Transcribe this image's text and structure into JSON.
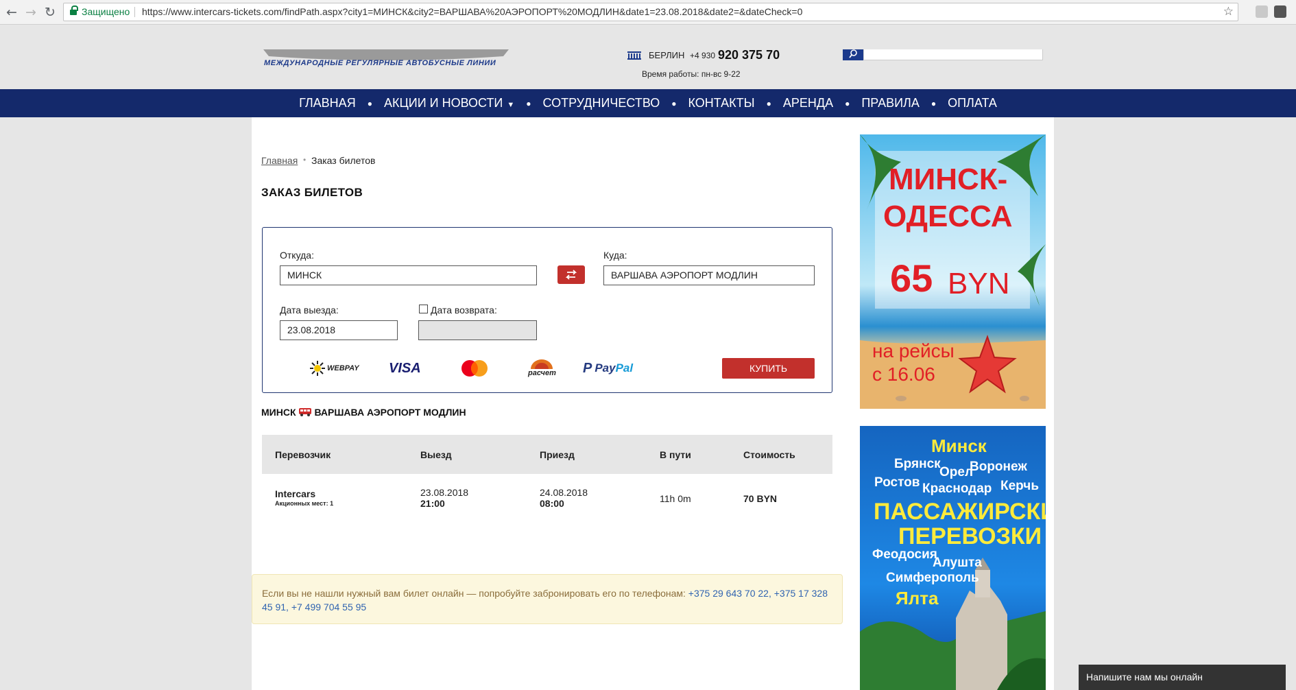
{
  "browser": {
    "secure_label": "Защищено",
    "url": "https://www.intercars-tickets.com/findPath.aspx?city1=МИНСК&city2=ВАРШАВА%20АЭРОПОРТ%20МОДЛИН&date1=23.08.2018&date2=&dateCheck=0"
  },
  "header": {
    "logo_tagline": "МЕЖДУНАРОДНЫЕ РЕГУЛЯРНЫЕ АВТОБУСНЫЕ ЛИНИИ",
    "city": "БЕРЛИН",
    "phone_prefix": "+4 930",
    "phone_main": "920 375 70",
    "hours": "Время работы: пн-вс 9-22"
  },
  "menu": {
    "items": [
      "ГЛАВНАЯ",
      "АКЦИИ И НОВОСТИ",
      "СОТРУДНИЧЕСТВО",
      "КОНТАКТЫ",
      "АРЕНДА",
      "ПРАВИЛА",
      "ОПЛАТА"
    ]
  },
  "breadcrumb": {
    "home": "Главная",
    "current": "Заказ билетов"
  },
  "page_title": "ЗАКАЗ БИЛЕТОВ",
  "form": {
    "from_label": "Откуда:",
    "from_value": "МИНСК",
    "to_label": "Куда:",
    "to_value": "ВАРШАВА АЭРОПОРТ МОДЛИН",
    "depart_label": "Дата выезда:",
    "depart_value": "23.08.2018",
    "return_label": "Дата возврата:",
    "return_value": "",
    "buy_label": "КУПИТЬ",
    "payments": {
      "webpay": "WEBPAY",
      "visa": "VISA",
      "raschet": "расчет",
      "paypal_pay": "Pay",
      "paypal_pal": "Pal"
    }
  },
  "route": {
    "from": "МИНСК",
    "to": "ВАРШАВА АЭРОПОРТ МОДЛИН"
  },
  "table": {
    "headers": [
      "Перевозчик",
      "Выезд",
      "Приезд",
      "В пути",
      "Стоимость"
    ],
    "rows": [
      {
        "carrier": "Intercars",
        "seats": "Акционных мест: 1",
        "depart_date": "23.08.2018",
        "depart_time": "21:00",
        "arrive_date": "24.08.2018",
        "arrive_time": "08:00",
        "duration": "11h 0m",
        "price": "70 BYN"
      }
    ]
  },
  "notice": {
    "text": "Если вы не нашли нужный вам билет онлайн — попробуйте забронировать его по телефонам:",
    "phones": "+375 29 643 70 22, +375 17 328 45 91, +7 499 704 55 95"
  },
  "banner1": {
    "line1": "МИНСК-",
    "line2": "ОДЕССА",
    "price": "65",
    "currency": "BYN",
    "sub1": "на рейсы",
    "sub2": "с 16.06"
  },
  "banner2": {
    "cities_top": [
      "Минск",
      "Брянск",
      "Воронеж",
      "Орел",
      "Ростов",
      "Краснодар",
      "Керчь"
    ],
    "title1": "ПАССАЖИРСКИЕ",
    "title2": "ПЕРЕВОЗКИ",
    "cities_bottom": [
      "Феодосия",
      "Алушта",
      "Симферополь",
      "Ялта"
    ]
  },
  "chat": {
    "label": "Напишите нам мы онлайн"
  },
  "colors": {
    "nav": "#14296b",
    "accent_red": "#c2302c",
    "notice_bg": "#fcf7de",
    "secure_green": "#0b8043"
  }
}
